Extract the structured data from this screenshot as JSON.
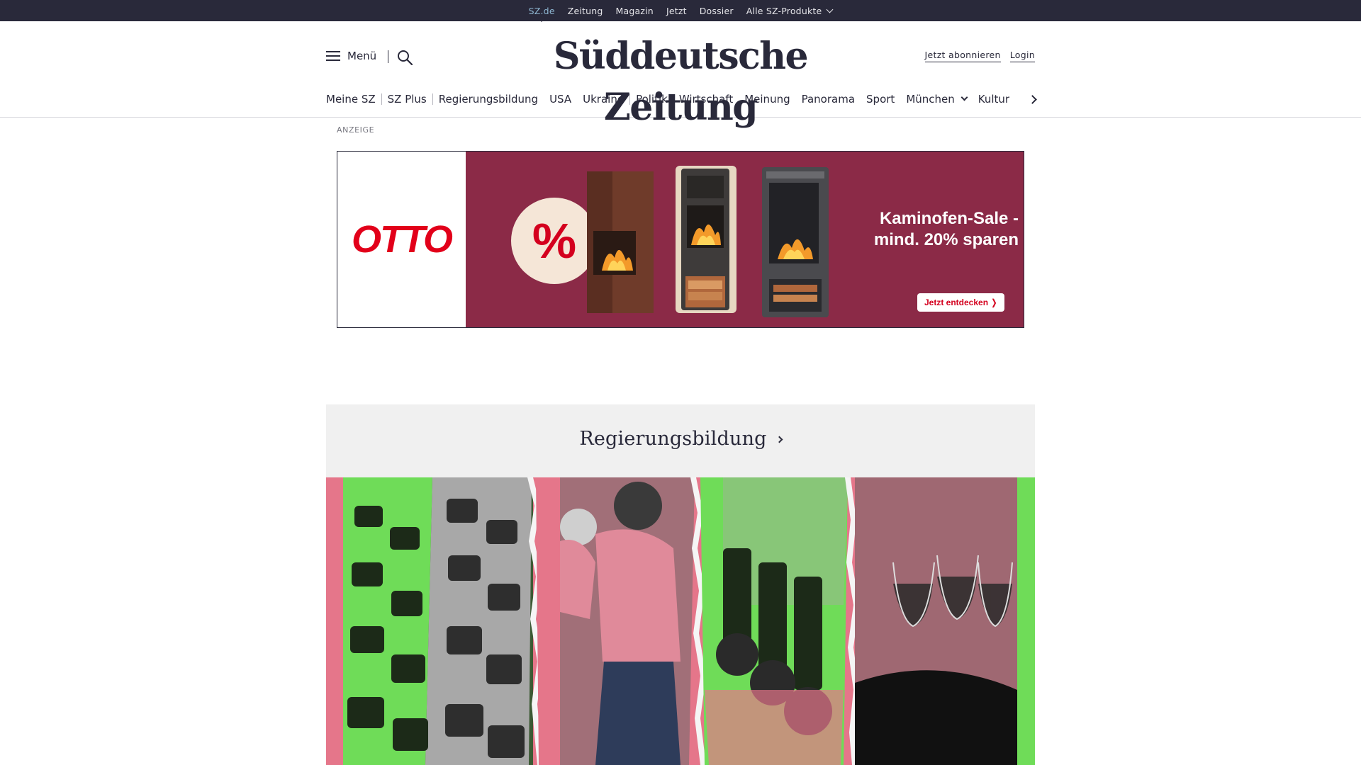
{
  "topbar": {
    "links": [
      "SZ.de",
      "Zeitung",
      "Magazin",
      "Jetzt",
      "Dossier",
      "Alle SZ-Produkte"
    ],
    "active_index": 0
  },
  "header": {
    "menu_label": "Menü",
    "logo_text": "Süddeutsche Zeitung",
    "subscribe_label": "Jetzt abonnieren",
    "login_label": "Login"
  },
  "nav": {
    "items": [
      "Meine SZ",
      "SZ Plus",
      "Regierungsbildung",
      "USA",
      "Ukraine",
      "Politik",
      "Wirtschaft",
      "Meinung",
      "Panorama",
      "Sport",
      "München",
      "Kultur"
    ]
  },
  "ad": {
    "label": "ANZEIGE",
    "brand": "OTTO",
    "symbol": "%",
    "title": "Kaminofen-Sale - mind. 20% sparen",
    "cta": "Jetzt entdecken ❭",
    "colors": {
      "background": "#8b2a47",
      "brand": "#e2001a"
    }
  },
  "section": {
    "title": "Regierungsbildung"
  },
  "colors": {
    "topbar": "#29293a",
    "text": "#29293a",
    "active_link": "#8fb7d2",
    "section_background": "#f0f0f0",
    "hero_pink": "#e5768a",
    "hero_green": "#6fdc58"
  }
}
